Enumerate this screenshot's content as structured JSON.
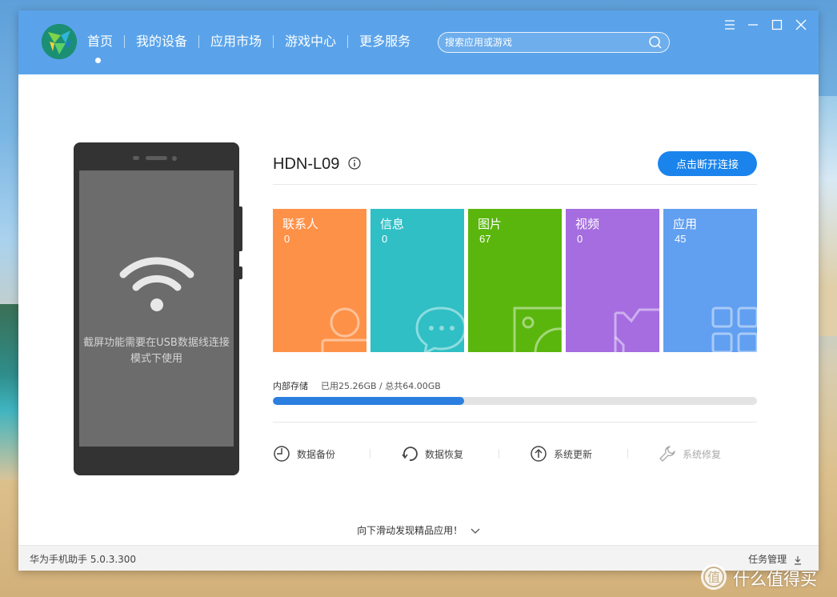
{
  "nav": {
    "items": [
      "首页",
      "我的设备",
      "应用市场",
      "游戏中心",
      "更多服务"
    ],
    "active_index": 0
  },
  "search": {
    "placeholder": "搜索应用或游戏"
  },
  "phone": {
    "message": "截屏功能需要在USB数据线连接模式下使用"
  },
  "device": {
    "name": "HDN-L09",
    "disconnect_label": "点击断开连接"
  },
  "tiles": [
    {
      "label": "联系人",
      "count": "0",
      "color": "#fe9148",
      "icon": "contact-icon"
    },
    {
      "label": "信息",
      "count": "0",
      "color": "#2fbfc5",
      "icon": "message-icon"
    },
    {
      "label": "图片",
      "count": "67",
      "color": "#5ab60d",
      "icon": "picture-icon"
    },
    {
      "label": "视频",
      "count": "0",
      "color": "#a56de0",
      "icon": "video-icon"
    },
    {
      "label": "应用",
      "count": "45",
      "color": "#619ff0",
      "icon": "apps-icon"
    }
  ],
  "storage": {
    "label": "内部存储",
    "usage_text": "已用25.26GB / 总共64.00GB",
    "used_fraction": 0.3947
  },
  "actions": [
    {
      "label": "数据备份",
      "icon": "backup-icon",
      "enabled": true
    },
    {
      "label": "数据恢复",
      "icon": "restore-icon",
      "enabled": true
    },
    {
      "label": "系统更新",
      "icon": "update-icon",
      "enabled": true
    },
    {
      "label": "系统修复",
      "icon": "wrench-icon",
      "enabled": false
    }
  ],
  "scroll_hint": "向下滑动发现精品应用！",
  "footer": {
    "version": "华为手机助手 5.0.3.300",
    "task_manager": "任务管理"
  },
  "watermark": {
    "text": "什么值得买"
  },
  "colors": {
    "titlebar": "#5aa3ea",
    "accent": "#1a84ec",
    "storage_fill": "#2b7fe0"
  }
}
